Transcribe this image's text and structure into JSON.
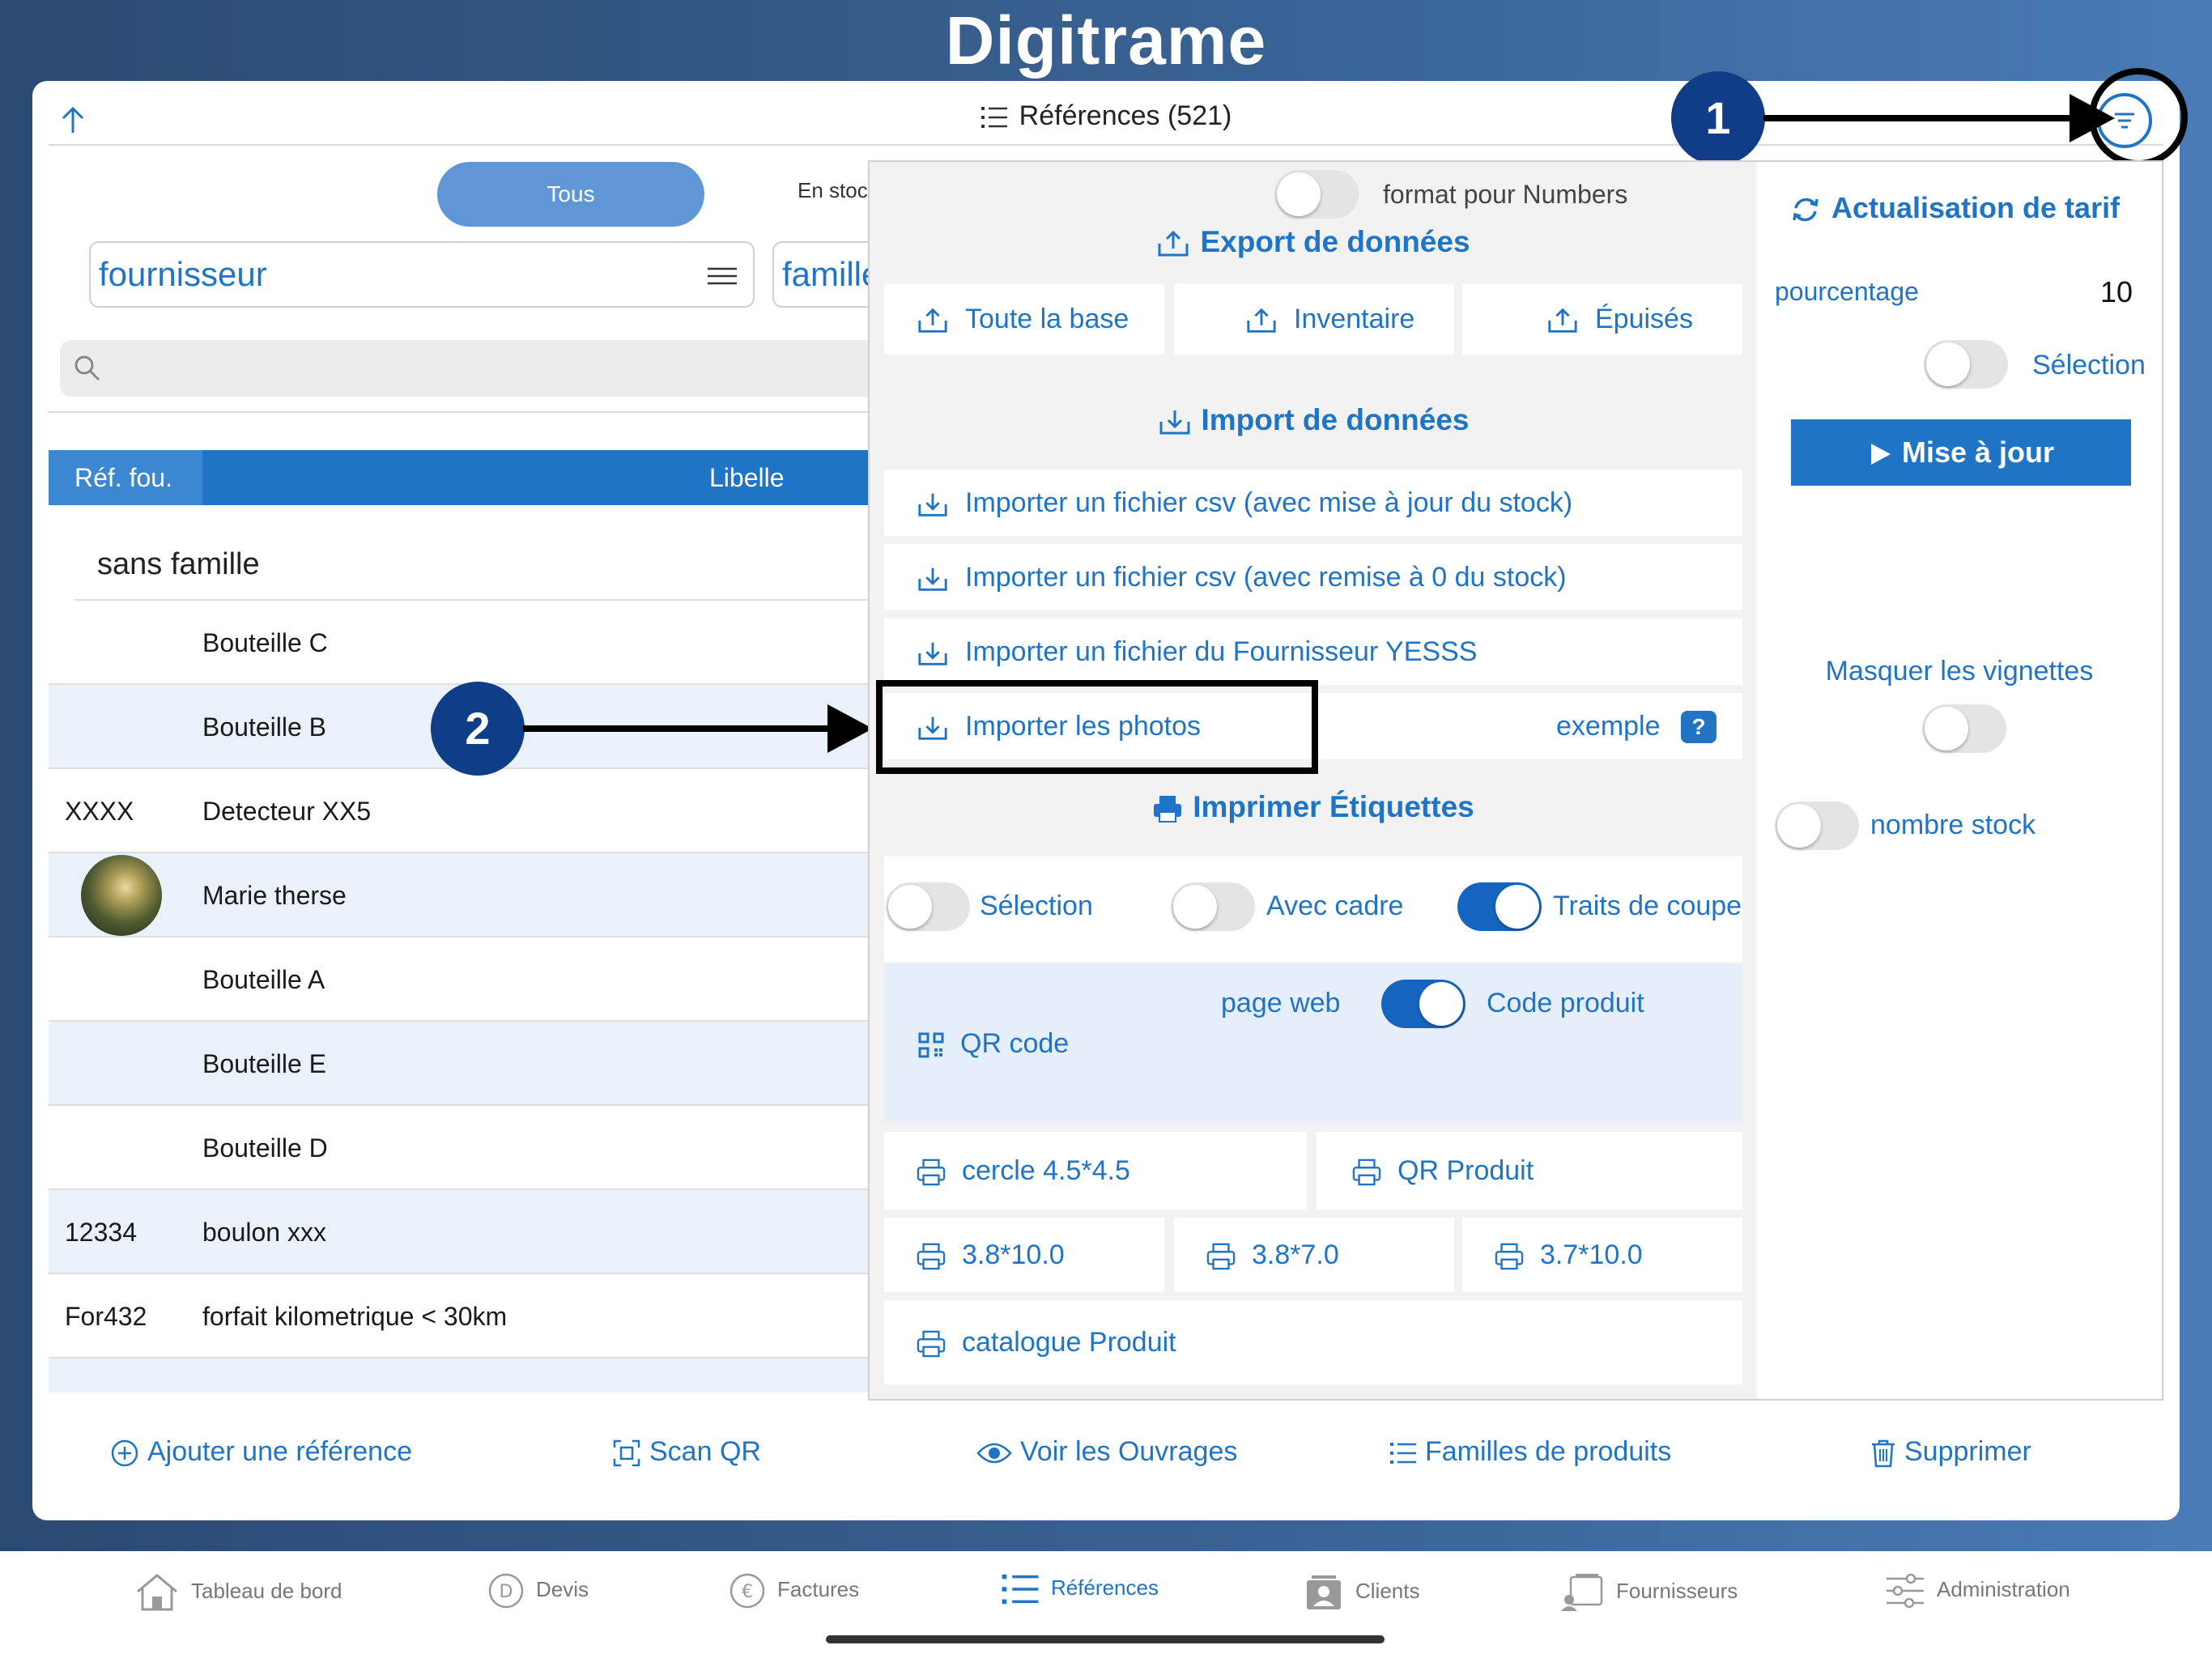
{
  "app": {
    "logo": "Digitrame",
    "title": "Références (521)"
  },
  "segments": {
    "all": "Tous",
    "stock": "En stoc"
  },
  "filters": {
    "supplier": "fournisseur",
    "family": "famille"
  },
  "table": {
    "headers": [
      "Réf. fou.",
      "Libelle"
    ],
    "group": "sans famille",
    "rows": [
      {
        "ref": "",
        "label": "Bouteille C"
      },
      {
        "ref": "",
        "label": "Bouteille B"
      },
      {
        "ref": "XXXX",
        "label": "Detecteur XX5"
      },
      {
        "ref": "",
        "label": "Marie therse"
      },
      {
        "ref": "",
        "label": "Bouteille A"
      },
      {
        "ref": "",
        "label": "Bouteille E"
      },
      {
        "ref": "",
        "label": "Bouteille D"
      },
      {
        "ref": "12334",
        "label": "boulon xxx"
      },
      {
        "ref": "For432",
        "label": "forfait kilometrique < 30km"
      }
    ]
  },
  "annotations": {
    "badge1": "1",
    "badge2": "2"
  },
  "popover": {
    "numbers_toggle": "format pour Numbers",
    "export_title": "Export de données",
    "export_buttons": [
      "Toute la base",
      "Inventaire",
      "Épuisés"
    ],
    "import_title": "Import de données",
    "import_items": [
      "Importer un fichier csv (avec mise à jour du stock)",
      "Importer un fichier csv (avec remise à 0 du stock)",
      "Importer un fichier du Fournisseur YESSS",
      "Importer les photos"
    ],
    "example": "exemple",
    "help": "?",
    "print_title": "Imprimer Étiquettes",
    "print_toggles": {
      "selection": "Sélection",
      "frame": "Avec cadre",
      "cut": "Traits de coupe"
    },
    "qr": {
      "label": "QR code",
      "web": "page web",
      "code": "Code produit"
    },
    "labels": [
      "cercle 4.5*4.5",
      "QR Produit",
      "3.8*10.0",
      "3.8*7.0",
      "3.7*10.0",
      "catalogue Produit"
    ]
  },
  "right_panel": {
    "title": "Actualisation de tarif",
    "percent_label": "pourcentage",
    "percent_value": "10",
    "selection": "Sélection",
    "update_btn": "Mise à jour",
    "hide_thumbs": "Masquer les vignettes",
    "stock_count": "nombre stock"
  },
  "actions": [
    "Ajouter une référence",
    "Scan QR",
    "Voir les Ouvrages",
    "Familles de produits",
    "Supprimer"
  ],
  "tabs": [
    "Tableau de bord",
    "Devis",
    "Factures",
    "Références",
    "Clients",
    "Fournisseurs",
    "Administration"
  ],
  "colors": {
    "accent": "#1f74c6",
    "badge": "#0f3d88",
    "header_bg": "#2b4a72"
  },
  "toggle_states": {
    "numbers": false,
    "right_selection": false,
    "hide_thumbs": false,
    "stock_count": false,
    "print_selection": false,
    "frame": false,
    "cut": true,
    "code_produit": true
  }
}
